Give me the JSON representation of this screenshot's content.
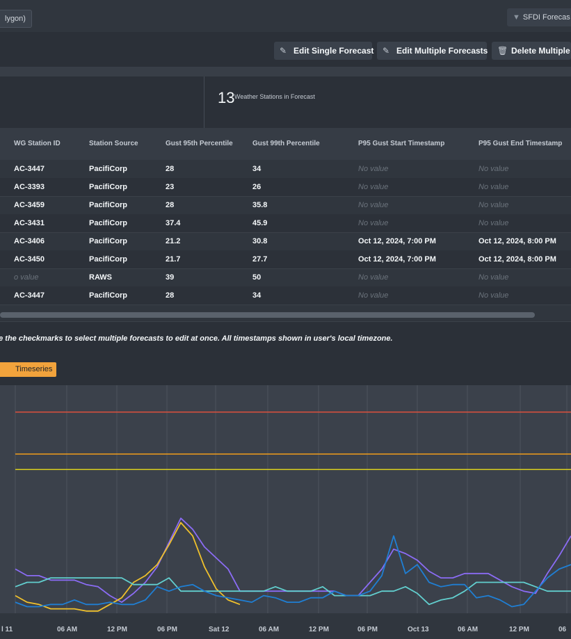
{
  "header": {
    "filter_chip": "lygon)",
    "sfdi_button": "SFDI Forecas"
  },
  "toolbar": {
    "edit_single": "Edit Single Forecast",
    "edit_multiple": "Edit Multiple Forecasts",
    "delete_multiple": "Delete Multiple"
  },
  "stats": {
    "count": "13",
    "label": "Weather Stations in Forecast"
  },
  "table": {
    "columns": [
      "WG Station ID",
      "Station Source",
      "Gust 95th Percentile",
      "Gust 99th Percentile",
      "P95 Gust Start Timestamp",
      "P95 Gust End Timestamp"
    ],
    "rows": [
      [
        "AC-3447",
        "PacifiCorp",
        "28",
        "34",
        "No value",
        "No value"
      ],
      [
        "AC-3393",
        "PacifiCorp",
        "23",
        "26",
        "No value",
        "No value"
      ],
      [
        "AC-3459",
        "PacifiCorp",
        "28",
        "35.8",
        "No value",
        "No value"
      ],
      [
        "AC-3431",
        "PacifiCorp",
        "37.4",
        "45.9",
        "No value",
        "No value"
      ],
      [
        "AC-3406",
        "PacifiCorp",
        "21.2",
        "30.8",
        "Oct 12, 2024, 7:00 PM",
        "Oct 12, 2024, 8:00 PM"
      ],
      [
        "AC-3450",
        "PacifiCorp",
        "21.7",
        "27.7",
        "Oct 12, 2024, 7:00 PM",
        "Oct 12, 2024, 8:00 PM"
      ],
      [
        "o value",
        "RAWS",
        "39",
        "50",
        "No value",
        "No value"
      ],
      [
        "AC-3447",
        "PacifiCorp",
        "28",
        "34",
        "No value",
        "No value"
      ]
    ]
  },
  "note": "se the checkmarks to select multiple forecasts to edit at once. All timestamps shown in user's local timezone.",
  "tabs": {
    "timeseries": "Timeseries"
  },
  "chart_data": {
    "type": "line",
    "x_tick_labels": [
      "l 11",
      "06 AM",
      "12 PM",
      "06 PM",
      "Sat 12",
      "06 AM",
      "12 PM",
      "06 PM",
      "Oct 13",
      "06 AM",
      "12 PM",
      "06"
    ],
    "threshold_lines": [
      {
        "color": "#e0513c",
        "level": 0.91
      },
      {
        "color": "#f29d1a",
        "level": 0.72
      },
      {
        "color": "#d8cf1f",
        "level": 0.65
      }
    ],
    "series": [
      {
        "color": "#8b6cf5",
        "values": [
          0.2,
          0.17,
          0.17,
          0.15,
          0.15,
          0.15,
          0.13,
          0.12,
          0.08,
          0.05,
          0.09,
          0.14,
          0.21,
          0.32,
          0.43,
          0.38,
          0.3,
          0.25,
          0.2,
          0.1,
          0.1,
          0.1,
          0.1,
          0.1,
          0.1,
          0.1,
          0.1,
          0.1,
          0.08,
          0.08,
          0.14,
          0.2,
          0.29,
          0.27,
          0.24,
          0.19,
          0.16,
          0.16,
          0.18,
          0.18,
          0.18,
          0.15,
          0.12,
          0.1,
          0.09,
          0.18,
          0.26,
          0.35
        ]
      },
      {
        "color": "#f0c12c",
        "values": [
          0.08,
          0.05,
          0.04,
          0.02,
          0.02,
          0.02,
          0.01,
          0.01,
          0.04,
          0.07,
          0.14,
          0.17,
          0.22,
          0.31,
          0.41,
          0.35,
          0.21,
          0.11,
          0.06,
          0.04
        ]
      },
      {
        "color": "#62cfcf",
        "values": [
          0.12,
          0.14,
          0.14,
          0.16,
          0.16,
          0.16,
          0.16,
          0.16,
          0.16,
          0.16,
          0.13,
          0.13,
          0.13,
          0.16,
          0.1,
          0.1,
          0.1,
          0.1,
          0.1,
          0.1,
          0.1,
          0.1,
          0.12,
          0.1,
          0.1,
          0.1,
          0.12,
          0.08,
          0.08,
          0.08,
          0.08,
          0.1,
          0.1,
          0.12,
          0.09,
          0.04,
          0.06,
          0.07,
          0.1,
          0.14,
          0.14,
          0.14,
          0.14,
          0.14,
          0.12,
          0.1,
          0.1,
          0.1,
          0.1
        ]
      },
      {
        "color": "#1f7fd4",
        "values": [
          0.05,
          0.03,
          0.03,
          0.04,
          0.04,
          0.06,
          0.04,
          0.04,
          0.05,
          0.04,
          0.04,
          0.06,
          0.12,
          0.1,
          0.12,
          0.13,
          0.1,
          0.08,
          0.07,
          0.06,
          0.05,
          0.08,
          0.07,
          0.05,
          0.05,
          0.07,
          0.07,
          0.1,
          0.08,
          0.08,
          0.1,
          0.17,
          0.35,
          0.18,
          0.22,
          0.14,
          0.12,
          0.13,
          0.13,
          0.07,
          0.08,
          0.06,
          0.03,
          0.04,
          0.1,
          0.16,
          0.2,
          0.22
        ]
      }
    ]
  }
}
